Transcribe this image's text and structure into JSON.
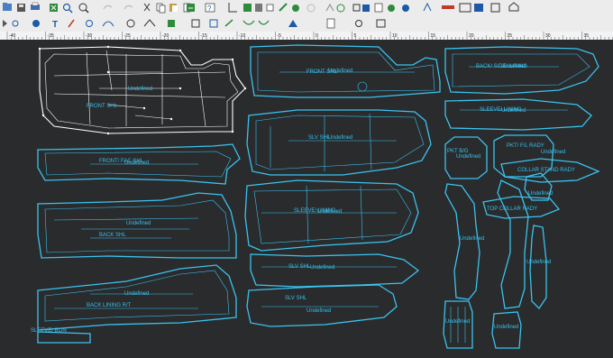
{
  "toolbar_top": {
    "buttons": [
      "open-icon",
      "save-icon",
      "print-icon",
      "fit-icon",
      "magnify-icon",
      "undo-icon",
      "redo-icon",
      "cut-icon",
      "copy-icon",
      "paste-icon",
      "delete-icon",
      "export-icon",
      "help-icon",
      "grid-icon",
      "measure-icon",
      "notch-icon",
      "table-icon",
      "drill-icon",
      "seam-icon",
      "rotate-icon",
      "flip-icon",
      "text-icon",
      "mark-icon",
      "layer-icon",
      "select-icon",
      "point-icon",
      "line-icon",
      "curve-icon",
      "piece-icon",
      "fold-icon"
    ]
  },
  "toolbar_second": {
    "buttons": [
      "select-arrow-icon",
      "node-icon",
      "dart-icon",
      "text-tool-icon",
      "pen-icon",
      "snap-icon",
      "curve-tool-icon",
      "circle-icon",
      "split-icon",
      "copy-piece-icon",
      "mirror-icon",
      "grade-icon",
      "join-icon",
      "sew-icon",
      "walk-icon",
      "area-icon",
      "page-icon",
      "settings-icon",
      "nest-icon"
    ]
  },
  "ruler": {
    "labels": [
      "-40",
      "-35",
      "-30",
      "-25",
      "-20",
      "-15",
      "-10",
      "-5",
      "0",
      "5",
      "10",
      "15",
      "20",
      "25",
      "30",
      "35"
    ]
  },
  "pieces": {
    "front_shl": "FRONT SHL",
    "undefined": "Undefined",
    "front_fac_shl": "FRONT/ FAC SHL",
    "back_shl": "BACK SHL",
    "back_lining": "BACK LINING R/T",
    "sleeve_bon": "SLEEVE/ BON",
    "front_shl_top": "FRONT SHL",
    "slv_shl": "SLV SHL",
    "sleeve_lining": "SLEEVE/ LINING",
    "slv_shl_2": "SLV SHL",
    "slv_shl_3": "SLV SHL",
    "back_side_lining": "BACK/ SIDE/ LINING",
    "sleeve_lining_r": "SLEEVE/ LINING",
    "pkt_bg": "PKT  B/G",
    "pkt_fl_rady": "PKT/ F/L  RADY",
    "collar_stand": "COLLAR STAND RADY",
    "top_collar": "TOP COLLAR  RADY"
  },
  "colors": {
    "canvas": "#2a2b2d",
    "piece_line": "#39c3ef",
    "selected_fill": "#6a6b6e",
    "toolbar": "#ececec"
  }
}
